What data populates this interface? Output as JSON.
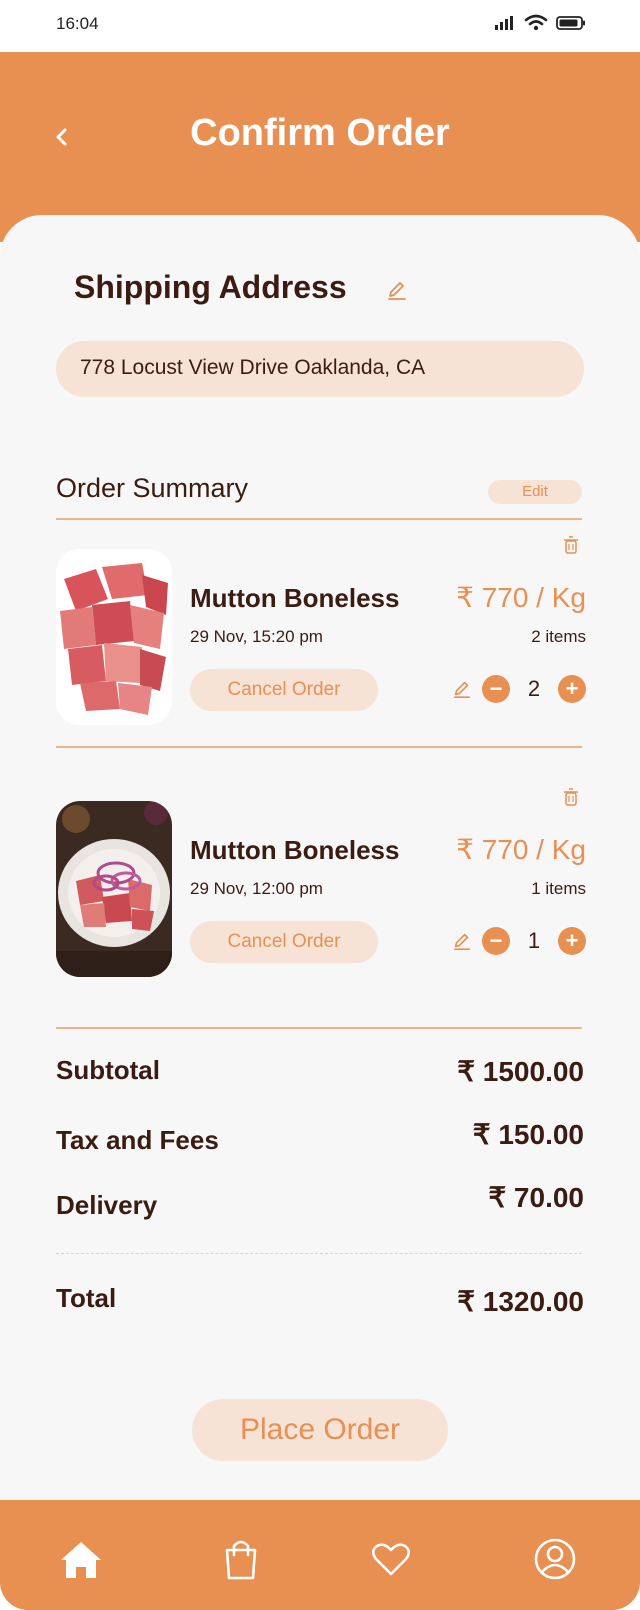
{
  "status_bar": {
    "time": "16:04"
  },
  "header": {
    "title": "Confirm Order",
    "back_icon": "chevron-left-icon"
  },
  "shipping": {
    "title": "Shipping Address",
    "address": "778 Locust View Drive Oaklanda, CA"
  },
  "summary": {
    "title": "Order Summary",
    "edit_label": "Edit"
  },
  "items": [
    {
      "name": "Mutton Boneless",
      "price": "₹ 770 / Kg",
      "date": "29 Nov, 15:20 pm",
      "count": "2 items",
      "cancel_label": "Cancel Order",
      "quantity": "2"
    },
    {
      "name": "Mutton Boneless",
      "price": "₹ 770 / Kg",
      "date": "29 Nov, 12:00 pm",
      "count": "1 items",
      "cancel_label": "Cancel Order",
      "quantity": "1"
    }
  ],
  "totals": {
    "subtotal_label": "Subtotal",
    "subtotal": "₹ 1500.00",
    "tax_label": "Tax and Fees",
    "tax": "₹ 150.00",
    "delivery_label": "Delivery",
    "delivery": "₹ 70.00",
    "total_label": "Total",
    "total": "₹ 1320.00"
  },
  "place_order_label": "Place Order",
  "nav": [
    "home-icon",
    "shopping-bag-icon",
    "heart-icon",
    "profile-icon"
  ],
  "colors": {
    "accent": "#e88f52",
    "soft": "#f6e3d6",
    "text": "#3a1c12",
    "background": "#f7f7f7"
  }
}
